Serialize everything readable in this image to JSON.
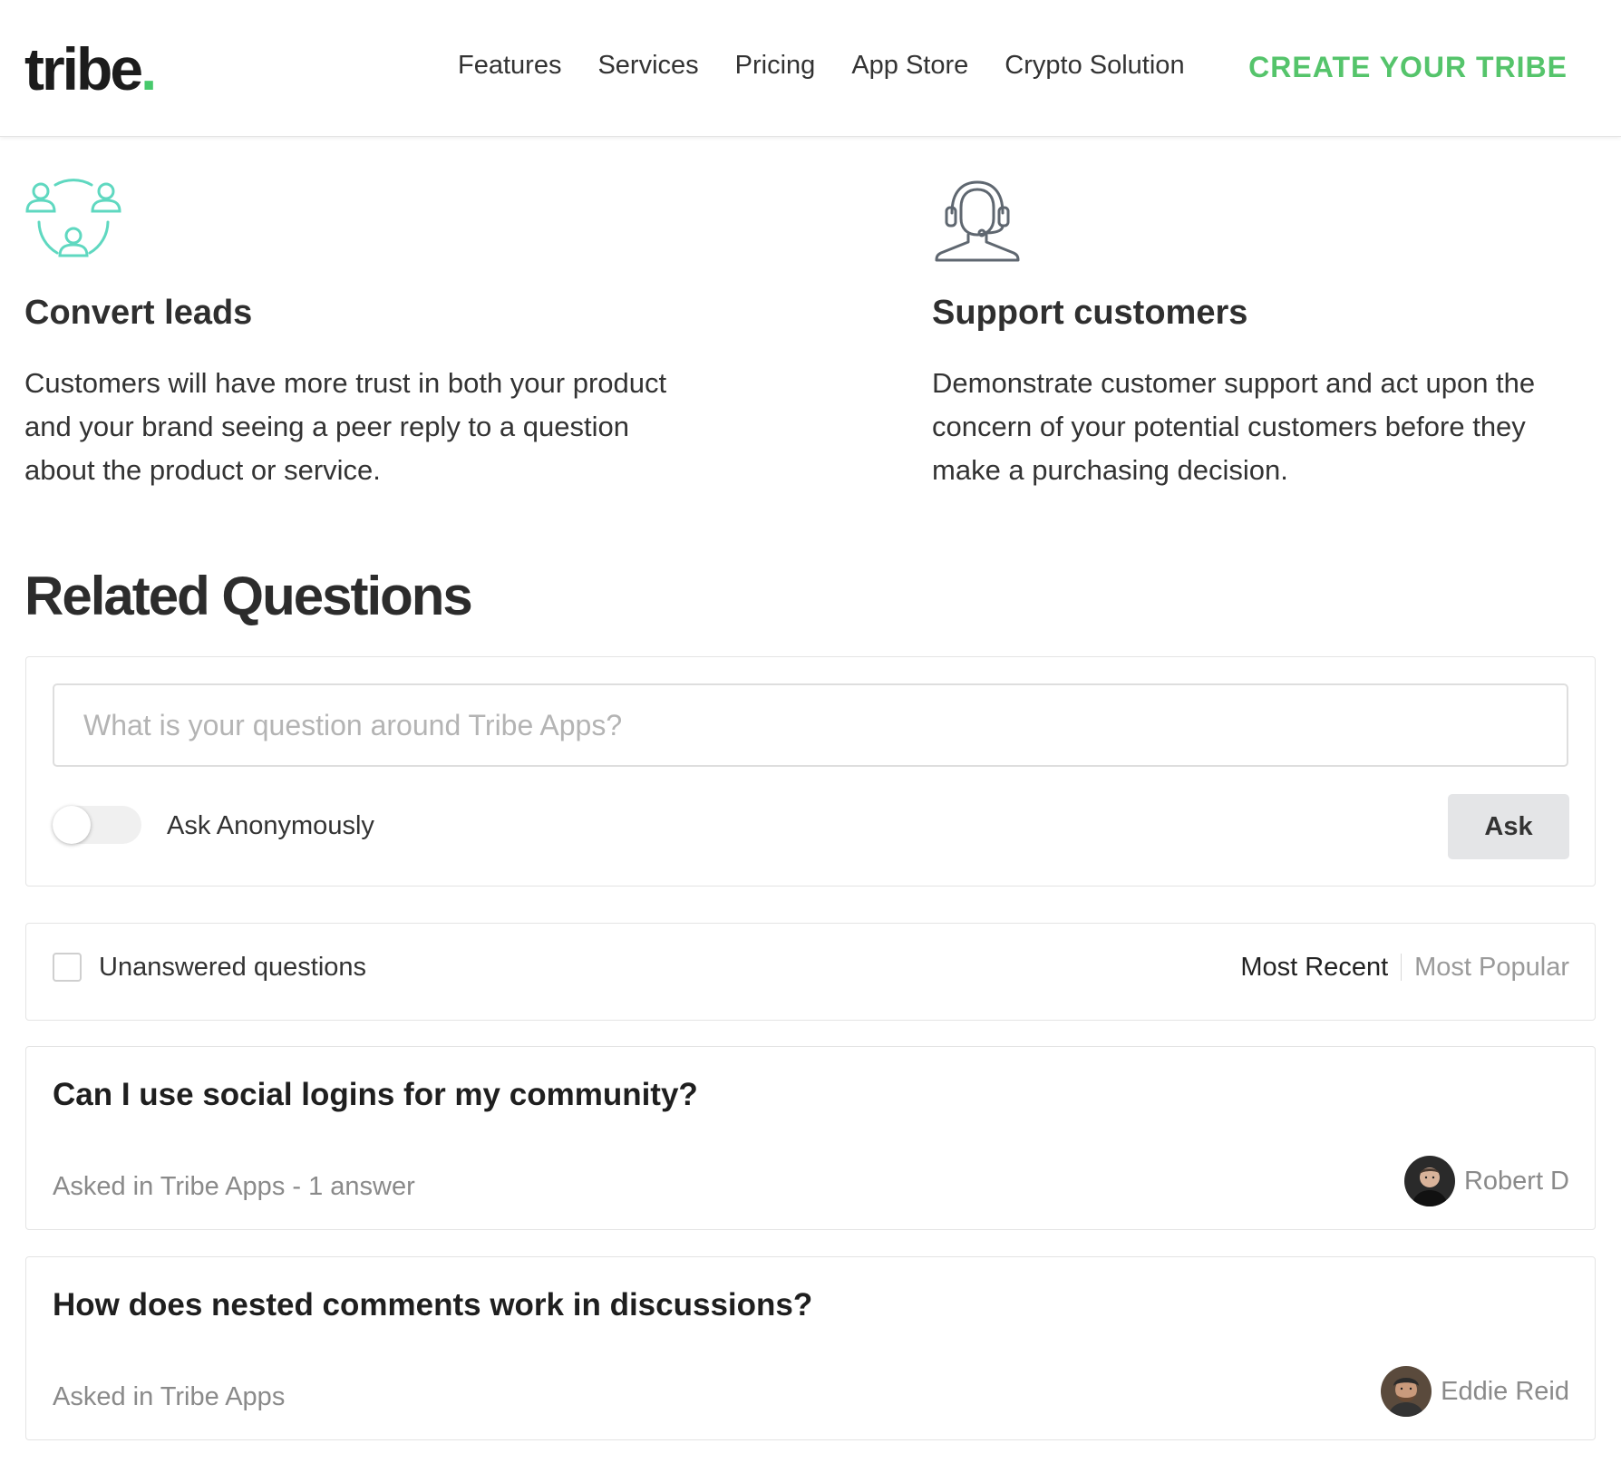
{
  "header": {
    "logo_text": "tribe",
    "logo_dot": ".",
    "nav": [
      "Features",
      "Services",
      "Pricing",
      "App Store",
      "Crypto Solution"
    ],
    "cta": "CREATE YOUR TRIBE"
  },
  "features": [
    {
      "icon": "people-network-icon",
      "title": "Convert leads",
      "text": "Customers will have more trust in both your product and your brand seeing a peer reply to a question about the product or service."
    },
    {
      "icon": "headset-support-icon",
      "title": "Support customers",
      "text": "Demonstrate customer support and act upon the concern of your potential customers before they make a purchasing decision."
    }
  ],
  "related": {
    "title": "Related Questions",
    "ask": {
      "placeholder": "What is your question around Tribe Apps?",
      "value": "",
      "anonymous_label": "Ask Anonymously",
      "anonymous_on": false,
      "button_label": "Ask"
    },
    "filter": {
      "unanswered_label": "Unanswered questions",
      "unanswered_checked": false,
      "sort_recent": "Most Recent",
      "sort_popular": "Most Popular",
      "active_sort": "Most Recent"
    },
    "questions": [
      {
        "title": "Can I use social logins for my community?",
        "meta": "Asked in Tribe Apps - 1 answer",
        "author": "Robert D"
      },
      {
        "title": "How does nested comments work in discussions?",
        "meta": "Asked in Tribe Apps",
        "author": "Eddie Reid"
      }
    ]
  },
  "colors": {
    "brand_green": "#55c46b",
    "feature_icon_teal": "#5fd8c0",
    "feature_icon_gray": "#5f6770"
  }
}
